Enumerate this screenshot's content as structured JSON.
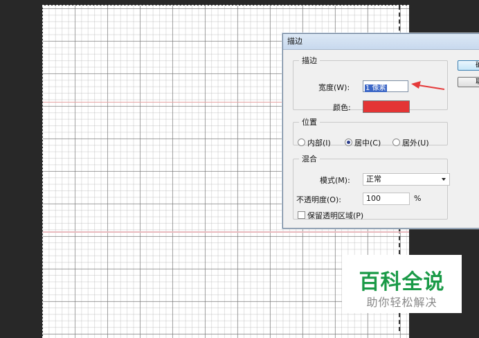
{
  "dialog": {
    "title": "描边",
    "stroke_group": {
      "legend": "描边",
      "width_label": "宽度(W):",
      "width_value": "1 像素",
      "color_label": "颜色:",
      "color_value": "#e33535"
    },
    "position_group": {
      "legend": "位置",
      "options": [
        {
          "label": "内部(I)",
          "selected": false
        },
        {
          "label": "居中(C)",
          "selected": true
        },
        {
          "label": "居外(U)",
          "selected": false
        }
      ]
    },
    "blend_group": {
      "legend": "混合",
      "mode_label": "模式(M):",
      "mode_value": "正常",
      "opacity_label": "不透明度(O):",
      "opacity_value": "100",
      "opacity_unit": "%",
      "preserve_label": "保留透明区域(P)",
      "preserve_checked": false
    },
    "buttons": [
      {
        "label": "确"
      },
      {
        "label": "取"
      }
    ]
  },
  "canvas": {
    "grid": true,
    "guide_color": "#e08b8b"
  },
  "watermark": {
    "title": "百科全说",
    "subtitle": "助你轻松解决",
    "color": "#1a9a47"
  }
}
